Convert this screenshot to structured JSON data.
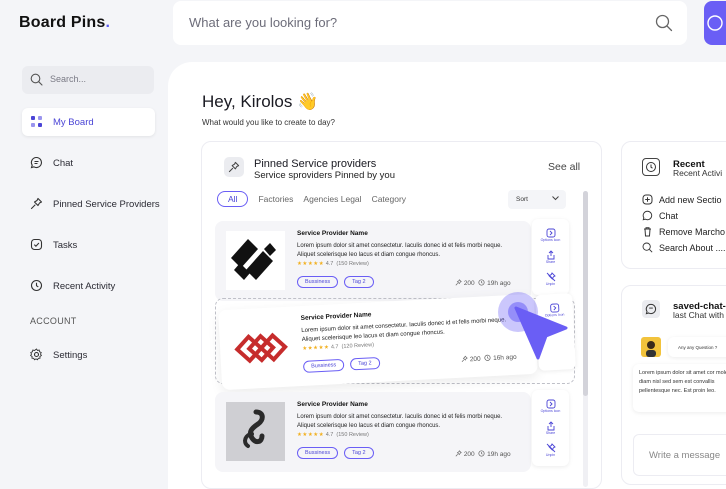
{
  "brand": {
    "name": "Board Pins",
    "dot": "."
  },
  "top_search": {
    "placeholder": "What are you looking for?"
  },
  "sidebar": {
    "search_placeholder": "Search...",
    "items": [
      {
        "label": "My Board",
        "icon": "grid-icon",
        "active": true
      },
      {
        "label": "Chat",
        "icon": "chat-icon"
      },
      {
        "label": "Pinned Service Providers",
        "icon": "pin-icon"
      },
      {
        "label": "Tasks",
        "icon": "task-check-icon"
      },
      {
        "label": "Recent Activity",
        "icon": "clock-icon"
      }
    ],
    "section_account": "ACCOUNT",
    "settings_label": "Settings"
  },
  "greeting": {
    "title": "Hey, Kirolos",
    "emoji": "👋",
    "subtitle": "What would you like to create to day?"
  },
  "pinned": {
    "title": "Pinned Service providers",
    "subtitle": "Service sproviders Pinned by you",
    "see_all": "See all",
    "filters": [
      "All",
      "Factories",
      "Agencies Legal",
      "Category"
    ],
    "sort_label": "Sort",
    "providers": [
      {
        "name": "Service Provider Name",
        "description": "Lorem ipsum dolor sit amet consectetur. Iaculis donec id et felis morbi neque. Aliquet scelerisque leo lacus et diam congue rhoncus.",
        "stars": "★★★★★",
        "rating": "4.7",
        "reviews": "(150 Review)",
        "tags": [
          "Bussiness",
          "Tag 2"
        ],
        "pins": "200",
        "time": "19h ago"
      },
      {
        "name": "Service Provider Name",
        "description": "Lorem ipsum dolor sit amet consectetur. Iaculis donec id et felis morbi neque. Aliquet scelerisque leo lacus et diam congue rhoncus.",
        "stars": "★★★★★",
        "rating": "4.7",
        "reviews": "(120 Review)",
        "tags": [
          "Bussiness",
          "Tag 2"
        ],
        "pins": "200",
        "time": "16h ago"
      },
      {
        "name": "Service Provider Name",
        "description": "Lorem ipsum dolor sit amet consectetur. Iaculis donec id et felis morbi neque. Aliquet scelerisque leo lacus et diam congue rhoncus.",
        "stars": "★★★★★",
        "rating": "4.7",
        "reviews": "(150 Review)",
        "tags": [
          "Bussiness",
          "Tag 2"
        ],
        "pins": "200",
        "time": "19h ago"
      }
    ],
    "actions": [
      "Options Icon",
      "Share",
      "Unpin"
    ]
  },
  "recent": {
    "title": "Recent",
    "subtitle": "Recent Activi",
    "items": [
      "Add new Sectio",
      "Chat",
      "Remove Marcho",
      "Search About ...."
    ]
  },
  "saved_chat": {
    "title": "saved-chat-",
    "subtitle": "last Chat with",
    "question": "Any any Question ?",
    "message": "Lorem ipsum dolor sit amet cor molestie diam nisl sed sem est convallis pellentesque nec. Est proin leo.",
    "input_placeholder": "Write a message"
  },
  "colors": {
    "accent": "#6a5ef5",
    "star": "#f2b122"
  }
}
